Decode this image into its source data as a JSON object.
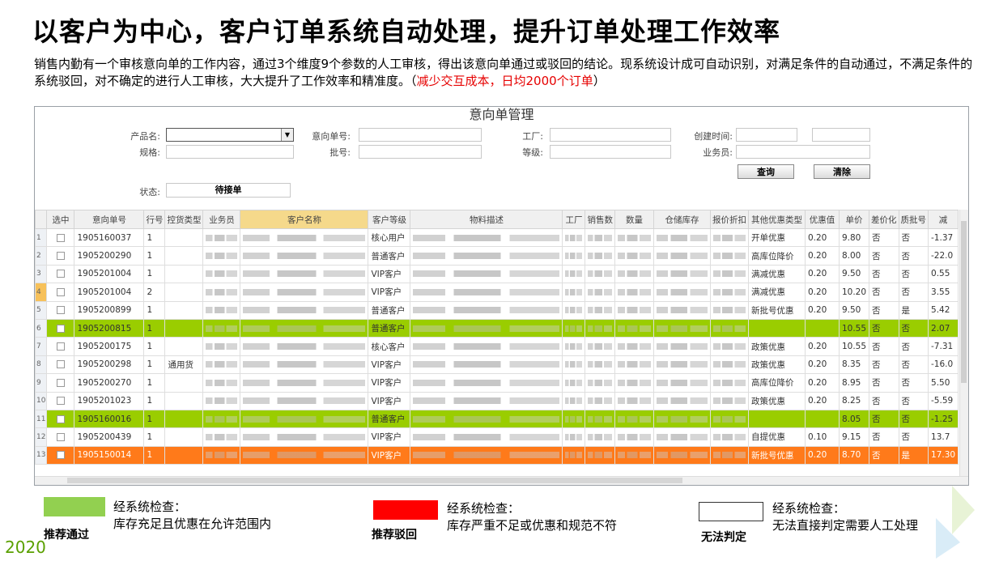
{
  "title": "以客户为中心，客户订单系统自动处理，提升订单处理工作效率",
  "description": "销售内勤有一个审核意向单的工作内容，通过3个维度9个参数的人工审核，得出该意向单通过或驳回的结论。现系统设计成可自动识别，对满足条件的自动通过，不满足条件的系统驳回，对不确定的进行人工审核，大大提升了工作效率和精准度。（",
  "description_highlight": "减少交互成本，日均2000个订单",
  "description_end": "）",
  "window": {
    "title": "意向单管理",
    "form": {
      "product_label": "产品名:",
      "spec_label": "规格:",
      "status_label": "状态:",
      "status_value": "待接单",
      "order_no_label": "意向单号:",
      "batch_label": "批号:",
      "factory_label": "工厂:",
      "grade_label": "等级:",
      "create_time_label": "创建时间:",
      "salesman_label": "业务员:",
      "query_button": "查询",
      "clear_button": "清除"
    },
    "columns": [
      "选中",
      "意向单号",
      "行号",
      "控货类型",
      "业务员",
      "客户名称",
      "客户等级",
      "物料描述",
      "工厂",
      "销售数",
      "数量",
      "仓储库存",
      "报价折扣",
      "其他优惠类型",
      "优惠值",
      "单价",
      "差价化",
      "质批号",
      "减"
    ],
    "rows": [
      {
        "n": "1",
        "order": "1905160037",
        "line": "1",
        "ctrl": "",
        "grade": "核心用户",
        "promo": "开单优惠",
        "val": "0.20",
        "price": "9.80",
        "f1": "否",
        "f2": "否",
        "last": "-1.37",
        "style": "normal"
      },
      {
        "n": "2",
        "order": "1905200290",
        "line": "1",
        "ctrl": "",
        "grade": "普通客户",
        "promo": "高库位降价",
        "val": "0.20",
        "price": "8.00",
        "f1": "否",
        "f2": "否",
        "last": "-22.0",
        "style": "normal"
      },
      {
        "n": "3",
        "order": "1905201004",
        "line": "1",
        "ctrl": "",
        "grade": "VIP客户",
        "promo": "满减优惠",
        "val": "0.20",
        "price": "9.50",
        "f1": "否",
        "f2": "否",
        "last": "0.55",
        "style": "normal"
      },
      {
        "n": "4",
        "order": "1905201004",
        "line": "2",
        "ctrl": "",
        "grade": "VIP客户",
        "promo": "满减优惠",
        "val": "0.20",
        "price": "10.20",
        "f1": "否",
        "f2": "否",
        "last": "3.55",
        "style": "normal"
      },
      {
        "n": "5",
        "order": "1905200899",
        "line": "1",
        "ctrl": "",
        "grade": "普通客户",
        "promo": "新批号优惠",
        "val": "0.20",
        "price": "9.50",
        "f1": "否",
        "f2": "是",
        "last": "5.42",
        "style": "normal"
      },
      {
        "n": "6",
        "order": "1905200815",
        "line": "1",
        "ctrl": "",
        "grade": "普通客户",
        "promo": "",
        "val": "",
        "price": "10.55",
        "f1": "否",
        "f2": "否",
        "last": "2.07",
        "style": "green"
      },
      {
        "n": "7",
        "order": "1905200175",
        "line": "1",
        "ctrl": "",
        "grade": "核心客户",
        "promo": "政策优惠",
        "val": "0.20",
        "price": "10.55",
        "f1": "否",
        "f2": "否",
        "last": "-7.31",
        "style": "normal"
      },
      {
        "n": "8",
        "order": "1905200298",
        "line": "1",
        "ctrl": "通用货",
        "grade": "VIP客户",
        "promo": "政策优惠",
        "val": "0.20",
        "price": "8.35",
        "f1": "否",
        "f2": "否",
        "last": "-16.0",
        "style": "normal"
      },
      {
        "n": "9",
        "order": "1905200270",
        "line": "1",
        "ctrl": "",
        "grade": "VIP客户",
        "promo": "高库位降价",
        "val": "0.20",
        "price": "8.95",
        "f1": "否",
        "f2": "否",
        "last": "5.50",
        "style": "normal"
      },
      {
        "n": "10",
        "order": "1905201023",
        "line": "1",
        "ctrl": "",
        "grade": "VIP客户",
        "promo": "政策优惠",
        "val": "0.20",
        "price": "8.25",
        "f1": "否",
        "f2": "否",
        "last": "-5.59",
        "style": "normal"
      },
      {
        "n": "11",
        "order": "1905160016",
        "line": "1",
        "ctrl": "",
        "grade": "普通客户",
        "promo": "",
        "val": "",
        "price": "8.05",
        "f1": "否",
        "f2": "否",
        "last": "-1.25",
        "style": "green"
      },
      {
        "n": "12",
        "order": "1905200439",
        "line": "1",
        "ctrl": "",
        "grade": "VIP客户",
        "promo": "自提优惠",
        "val": "0.10",
        "price": "9.15",
        "f1": "否",
        "f2": "否",
        "last": "13.7",
        "style": "normal"
      },
      {
        "n": "13",
        "order": "1905150014",
        "line": "1",
        "ctrl": "",
        "grade": "VIP客户",
        "promo": "新批号优惠",
        "val": "0.20",
        "price": "8.70",
        "f1": "否",
        "f2": "是",
        "last": "17.30",
        "style": "orange"
      }
    ]
  },
  "legend": [
    {
      "name": "推荐通过",
      "line1": "经系统检查：",
      "line2": "库存充足且优惠在允许范围内",
      "color": "#92d050"
    },
    {
      "name": "推荐驳回",
      "line1": "经系统检查：",
      "line2": "库存严重不足或优惠和规范不符",
      "color": "#ff0000"
    },
    {
      "name": "无法判定",
      "line1": "经系统检查：",
      "line2": "无法直接判定需要人工处理",
      "color": "#ffffff"
    }
  ],
  "year": "2020"
}
